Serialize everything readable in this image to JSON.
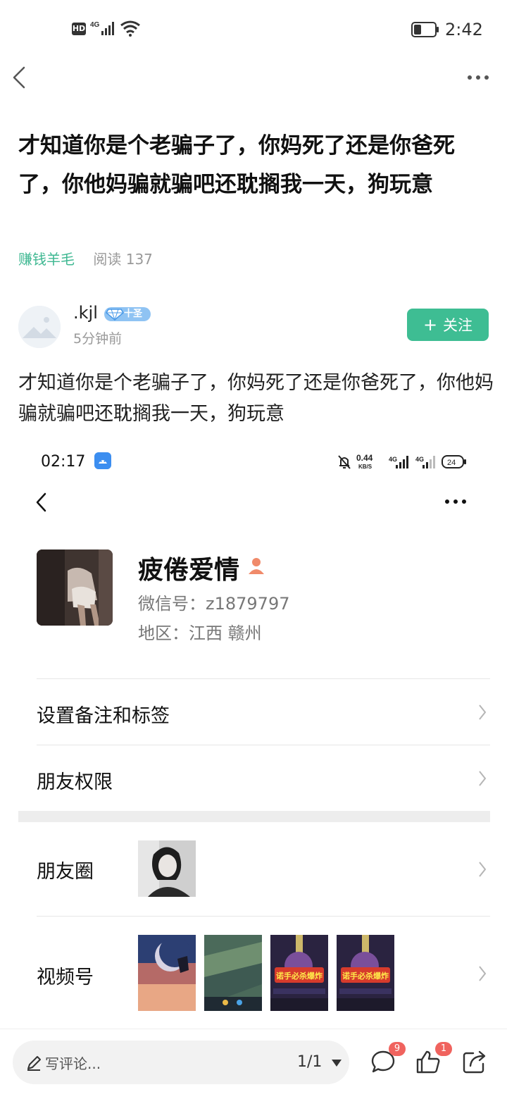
{
  "status_bar": {
    "hd": "HD",
    "network": "4G",
    "time": "2:42"
  },
  "post": {
    "title": "才知道你是个老骗子了，你妈死了还是你爸死了，你他妈骗就骗吧还耽搁我一天，狗玩意",
    "category": "赚钱羊毛",
    "reads": "阅读 137",
    "author": {
      "name": ".kjl",
      "badge": "十圣",
      "time": "5分钟前"
    },
    "follow_label": "关注",
    "body": "才知道你是个老骗子了，你妈死了还是你爸死了，你他妈骗就骗吧还耽搁我一天，狗玩意"
  },
  "screenshot": {
    "time": "02:17",
    "net_speed": "0.44",
    "net_unit": "KB/S",
    "battery": "24",
    "profile": {
      "name": "疲倦爱情",
      "wechat_id": "微信号：z1879797",
      "region": "地区：江西  赣州"
    },
    "rows": {
      "remark": "设置备注和标签",
      "permissions": "朋友权限",
      "moments": "朋友圈",
      "channels": "视频号"
    },
    "thumb_caption": "诺手必杀爆炸"
  },
  "bottom_bar": {
    "comment_placeholder": "写评论...",
    "pager": "1/1",
    "comment_count": "9",
    "like_count": "1"
  }
}
